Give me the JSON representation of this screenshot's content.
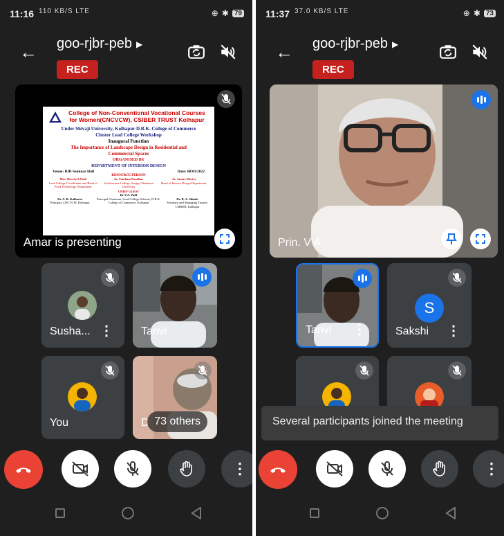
{
  "left": {
    "status": {
      "time": "11:16",
      "signal": "110 KB/S LTE",
      "battery": "79"
    },
    "meeting_code": "goo-rjbr-peb",
    "rec_label": "REC",
    "presenting_label": "Amar is presenting",
    "slide": {
      "title_line1": "College of Non-Conventional Vocational Courses",
      "title_line2": "for Women(CNCVCW), CSIBER TRUST Kolhapur",
      "line3": "Under Shivaji University, Kolhapur D.R.K. College of Commerce",
      "line4": "Cluster Lead College Workshop",
      "line5": "Inaugural Function",
      "line6": "The Importance of Landscape Design in Residential and",
      "line7": "Commercial Spaces",
      "organised_by": "ORGANISED BY",
      "dept": "DEPARTMENT OF INTERIOR DESIGN",
      "venue": "Venue: BID Seminar Hall",
      "date": "Date: 08/01/2022",
      "resource_person": "RESOURCE PERSON",
      "p1_name": "Mrs. Shweta A.Patil",
      "p1_role": "Lead College Coordinator and Head of Food Technology Department",
      "p2_name": "Ar. Vandana Pusalkar",
      "p2_role": "Architecture College, Sanjay Ghodawat University",
      "p3_name": "Ar. Amare Mestry",
      "p3_role": "Head of Interior Design Department.",
      "chief_guest": "CHIEF GUEST",
      "cg_name": "Dr V.A. Patil",
      "cg_role": "Principal Chairman, Lead College Scheme, D.R.K. College of Commerce, Kolhapur",
      "p4_name": "Dr. A. R. Kulkarni",
      "p4_role": "Principal, CNCVCW, Kolhapur",
      "p5_name": "Dr. R. A. Shinde",
      "p5_role": "Secretary and Managing Trustee, CSIBER, Kolhapur"
    },
    "tiles": [
      {
        "name": "Susha...",
        "muted": true
      },
      {
        "name": "Tanvi",
        "speaking": true
      },
      {
        "name": "You",
        "muted": true
      },
      {
        "name": "D",
        "muted": true,
        "overlay": "73 others"
      }
    ]
  },
  "right": {
    "status": {
      "time": "11:37",
      "signal": "37.0 KB/S LTE",
      "battery": "73"
    },
    "meeting_code": "goo-rjbr-peb",
    "rec_label": "REC",
    "main_name": "Prin. V A",
    "tiles": [
      {
        "name": "Tanvi",
        "speaking": true
      },
      {
        "name": "Sakshi",
        "initial": "S",
        "muted": true
      },
      {
        "name": "",
        "muted": true
      },
      {
        "name": "",
        "muted": true
      }
    ],
    "toast": "Several participants joined the meeting"
  },
  "colors": {
    "hangup": "#ea4335",
    "rec": "#c5221f",
    "speaking": "#1a73e8",
    "tile": "#3c4043",
    "bg": "#1f1f1f"
  },
  "icons": [
    "back-arrow-icon",
    "switch-camera-icon",
    "speaker-off-icon",
    "mic-off-icon",
    "fullscreen-icon",
    "pin-icon",
    "hangup-icon",
    "camera-off-icon",
    "raise-hand-icon",
    "more-icon",
    "nav-back-icon",
    "nav-home-icon",
    "nav-recents-icon"
  ]
}
